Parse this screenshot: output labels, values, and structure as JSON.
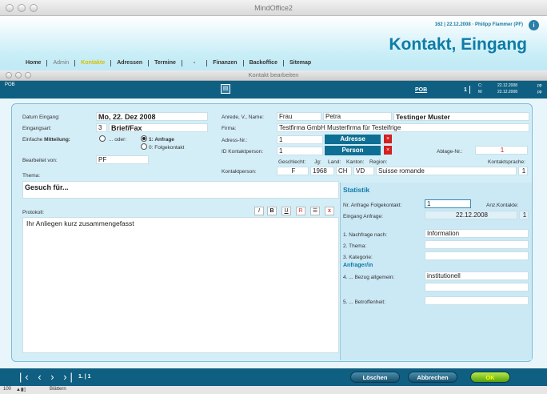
{
  "window": {
    "title": "MindOffice2"
  },
  "header": {
    "userinfo": "162 | 22.12.2008 · Philipp Flammer (PF)",
    "help": "i",
    "title": "Kontakt, Eingang"
  },
  "nav": [
    "Home",
    "Admin",
    "Kontakte",
    "Adressen",
    "Termine",
    "-",
    "Finanzen",
    "Backoffice",
    "Sitemap"
  ],
  "inner": {
    "title": "Kontakt bearbeiten",
    "pob_left": "POB",
    "pob_right": "POB",
    "page_num": "1",
    "c_label": "C:",
    "c_date": "22.12.2008",
    "m_label": "M:",
    "m_date": "22.12.2008",
    "c_user": "pp",
    "m_user": "pp"
  },
  "form": {
    "datum_label": "Datum Eingang:",
    "datum_value": "Mo, 22. Dez 2008",
    "eingangsart_label": "Eingangsart:",
    "eingangsart_num": "3",
    "eingangsart_value": "Brief/Fax",
    "mitteilung_label_a": "Einfache",
    "mitteilung_label_b": "Mitteilung:",
    "oder": "... oder:",
    "opt1": "1: Anfrage",
    "opt0": "0: Folgekontakt",
    "bearbeitet_label": "Bearbeitet von:",
    "bearbeitet_value": "PF",
    "thema_label": "Thema:",
    "thema_value": "Gesuch für...",
    "protokoll_label": "Protokoll:",
    "protokoll_value": "Ihr Anliegen kurz zusammengefasst",
    "fmt_i": "I",
    "fmt_b": "B",
    "fmt_u": "U",
    "fmt_r": "R",
    "fmt_list": "☰",
    "fmt_x": "x",
    "anrede_label": "Anrede, V., Name:",
    "anrede": "Frau",
    "vorname": "Petra",
    "name": "Testinger Muster",
    "firma_label": "Firma:",
    "firma": "Testfirma GmbH Musterfirma für Testeifrige",
    "adressnr_label": "Adress-Nr.:",
    "adressnr": "1",
    "adresse_btn": "Adresse",
    "idkontakt_label": "ID Kontaktperson:",
    "idkontakt": "1",
    "person_btn": "Person",
    "ablage_label": "Ablage-Nr.:",
    "ablage": "1",
    "kontaktperson_label": "Kontaktperson:",
    "geschlecht_label": "Geschlecht:",
    "jg_label": "Jg:",
    "land_label": "Land:",
    "kanton_label": "Kanton:",
    "region_label": "Region:",
    "sprache_label": "Kontaktsprache:",
    "geschlecht": "F",
    "jg": "1968",
    "land": "CH",
    "kanton": "VD",
    "region": "Suisse romande",
    "sprache": "1"
  },
  "statistik": {
    "title": "Statistik",
    "folge_label": "Nr. Anfrage Folgekontakt:",
    "folge": "1",
    "anz_label": "Anz.Kontakte:",
    "eingang_label": "Eingang Anfrage:",
    "eingang": "22.12.2008",
    "anz": "1",
    "nachfrage_label": "1. Nachfrage nach:",
    "nachfrage": "Information",
    "thema_label": "2. Thema:",
    "kategorie_label": "3. Kategorie:",
    "anfrager_title": "Anfrager/in",
    "bezug_label": "4. ... Bezug allgemein:",
    "bezug": "institutionell",
    "betroffenheit_label": "5. ... Betroffenheit:"
  },
  "footer": {
    "page": "1. | 1",
    "loeschen": "Löschen",
    "abbrechen": "Abbrechen",
    "ok": "OK",
    "zoom": "100",
    "mode": "Blättern"
  }
}
